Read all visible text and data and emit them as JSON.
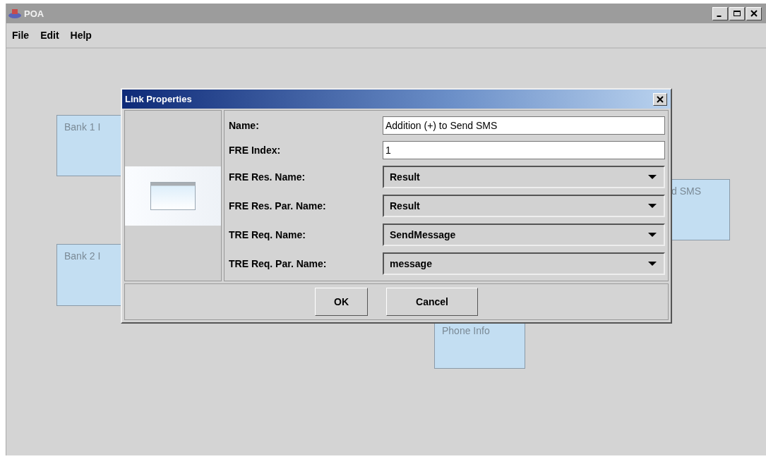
{
  "window": {
    "title": "POA"
  },
  "menu": [
    "File",
    "Edit",
    "Help"
  ],
  "canvas_nodes": [
    {
      "label": "Bank 1 I"
    },
    {
      "label": "Bank 2 I"
    },
    {
      "label": "d SMS"
    },
    {
      "label": "Phone Info"
    }
  ],
  "dialog": {
    "title": "Link Properties",
    "fields": [
      {
        "kind": "text",
        "label": "Name:",
        "value": "Addition (+) to Send SMS"
      },
      {
        "kind": "text",
        "label": "FRE Index:",
        "value": "1"
      },
      {
        "kind": "combo",
        "label": "FRE Res. Name:",
        "value": "Result"
      },
      {
        "kind": "combo",
        "label": "FRE Res. Par. Name:",
        "value": "Result"
      },
      {
        "kind": "combo",
        "label": "TRE Req. Name:",
        "value": "SendMessage"
      },
      {
        "kind": "combo",
        "label": "TRE Req. Par. Name:",
        "value": "message"
      }
    ],
    "buttons": [
      "OK",
      "Cancel"
    ]
  }
}
